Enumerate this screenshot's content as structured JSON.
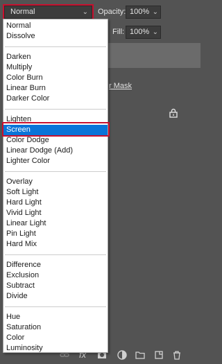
{
  "blend_mode": {
    "current": "Normal"
  },
  "opacity": {
    "label": "Opacity:",
    "value": "100%"
  },
  "fill": {
    "label": "Fill:",
    "value": "100%"
  },
  "layers": {
    "mask_label": "r Mask"
  },
  "menu": {
    "groups": [
      [
        "Normal",
        "Dissolve"
      ],
      [
        "Darken",
        "Multiply",
        "Color Burn",
        "Linear Burn",
        "Darker Color"
      ],
      [
        "Lighten",
        "Screen",
        "Color Dodge",
        "Linear Dodge (Add)",
        "Lighter Color"
      ],
      [
        "Overlay",
        "Soft Light",
        "Hard Light",
        "Vivid Light",
        "Linear Light",
        "Pin Light",
        "Hard Mix"
      ],
      [
        "Difference",
        "Exclusion",
        "Subtract",
        "Divide"
      ],
      [
        "Hue",
        "Saturation",
        "Color",
        "Luminosity"
      ]
    ],
    "selected": "Screen"
  },
  "colors": {
    "selection": "#0a74d8",
    "highlight_outline": "#c8102e",
    "panel_bg": "#535353"
  },
  "icons": [
    "link-icon",
    "fx-icon",
    "mask-icon",
    "adjustment-icon",
    "folder-icon",
    "new-layer-icon",
    "trash-icon"
  ]
}
